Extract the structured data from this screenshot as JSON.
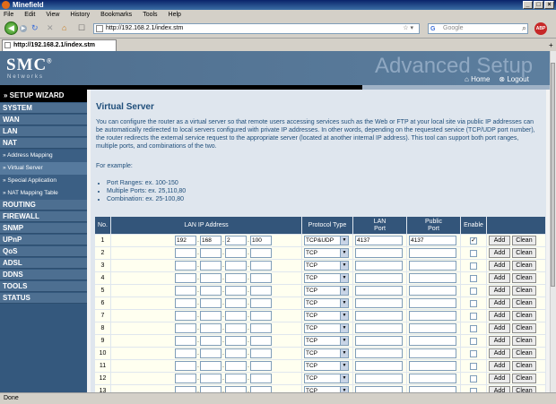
{
  "window": {
    "title": "Minefield"
  },
  "menu": [
    "File",
    "Edit",
    "View",
    "History",
    "Bookmarks",
    "Tools",
    "Help"
  ],
  "address": {
    "url": "http://192.168.2.1/index.stm"
  },
  "search": {
    "placeholder": "Google",
    "engine": "G"
  },
  "addon": {
    "label": "ABP"
  },
  "tab": {
    "title": "http://192.168.2.1/index.stm"
  },
  "banner": {
    "logo": "SMC",
    "reg": "®",
    "tagline": "Networks",
    "heading": "Advanced Setup",
    "home": "Home",
    "logout": "Logout"
  },
  "sidebar": {
    "wizard": "» SETUP WIZARD",
    "top": [
      "SYSTEM",
      "WAN",
      "LAN",
      "NAT"
    ],
    "sub": [
      "» Address Mapping",
      "» Virtual Server",
      "» Special Application",
      "» NAT Mapping Table"
    ],
    "bottom": [
      "ROUTING",
      "FIREWALL",
      "SNMP",
      "UPnP",
      "QoS",
      "ADSL",
      "DDNS",
      "TOOLS",
      "STATUS"
    ]
  },
  "page": {
    "title": "Virtual Server",
    "description": "You can configure the router as a virtual server so that remote users accessing services such as the Web or FTP at your local site via public IP addresses can be automatically redirected to local servers configured with private IP addresses. In other words, depending on the requested service (TCP/UDP port number), the router redirects the external service request to the appropriate server (located at another internal IP address). This tool can support both port ranges, multiple ports, and combinations of the two.",
    "for_example": "For example:",
    "examples": [
      "Port Ranges: ex. 100-150",
      "Multiple Ports: ex. 25,110,80",
      "Combination: ex. 25-100,80"
    ]
  },
  "table": {
    "headers": {
      "no": "No.",
      "ip": "LAN IP Address",
      "proto": "Protocol Type",
      "lan": "LAN\nPort",
      "public": "Public\nPort",
      "enable": "Enable"
    },
    "add_label": "Add",
    "clean_label": "Clean",
    "rows": [
      {
        "no": "1",
        "ip": [
          "192",
          "168",
          "2",
          "100"
        ],
        "protocol": "TCP&UDP",
        "lan_port": "4137",
        "public_port": "4137",
        "enabled": true
      },
      {
        "no": "2",
        "ip": [
          "",
          "",
          "",
          ""
        ],
        "protocol": "TCP",
        "lan_port": "",
        "public_port": "",
        "enabled": false
      },
      {
        "no": "3",
        "ip": [
          "",
          "",
          "",
          ""
        ],
        "protocol": "TCP",
        "lan_port": "",
        "public_port": "",
        "enabled": false
      },
      {
        "no": "4",
        "ip": [
          "",
          "",
          "",
          ""
        ],
        "protocol": "TCP",
        "lan_port": "",
        "public_port": "",
        "enabled": false
      },
      {
        "no": "5",
        "ip": [
          "",
          "",
          "",
          ""
        ],
        "protocol": "TCP",
        "lan_port": "",
        "public_port": "",
        "enabled": false
      },
      {
        "no": "6",
        "ip": [
          "",
          "",
          "",
          ""
        ],
        "protocol": "TCP",
        "lan_port": "",
        "public_port": "",
        "enabled": false
      },
      {
        "no": "7",
        "ip": [
          "",
          "",
          "",
          ""
        ],
        "protocol": "TCP",
        "lan_port": "",
        "public_port": "",
        "enabled": false
      },
      {
        "no": "8",
        "ip": [
          "",
          "",
          "",
          ""
        ],
        "protocol": "TCP",
        "lan_port": "",
        "public_port": "",
        "enabled": false
      },
      {
        "no": "9",
        "ip": [
          "",
          "",
          "",
          ""
        ],
        "protocol": "TCP",
        "lan_port": "",
        "public_port": "",
        "enabled": false
      },
      {
        "no": "10",
        "ip": [
          "",
          "",
          "",
          ""
        ],
        "protocol": "TCP",
        "lan_port": "",
        "public_port": "",
        "enabled": false
      },
      {
        "no": "11",
        "ip": [
          "",
          "",
          "",
          ""
        ],
        "protocol": "TCP",
        "lan_port": "",
        "public_port": "",
        "enabled": false
      },
      {
        "no": "12",
        "ip": [
          "",
          "",
          "",
          ""
        ],
        "protocol": "TCP",
        "lan_port": "",
        "public_port": "",
        "enabled": false
      },
      {
        "no": "13",
        "ip": [
          "",
          "",
          "",
          ""
        ],
        "protocol": "TCP",
        "lan_port": "",
        "public_port": "",
        "enabled": false
      }
    ]
  },
  "status": {
    "text": "Done"
  },
  "colors": {
    "sidebar": "#34587d",
    "header": "#33557a",
    "title": "#1f4e7a",
    "row": "#fffff0"
  }
}
